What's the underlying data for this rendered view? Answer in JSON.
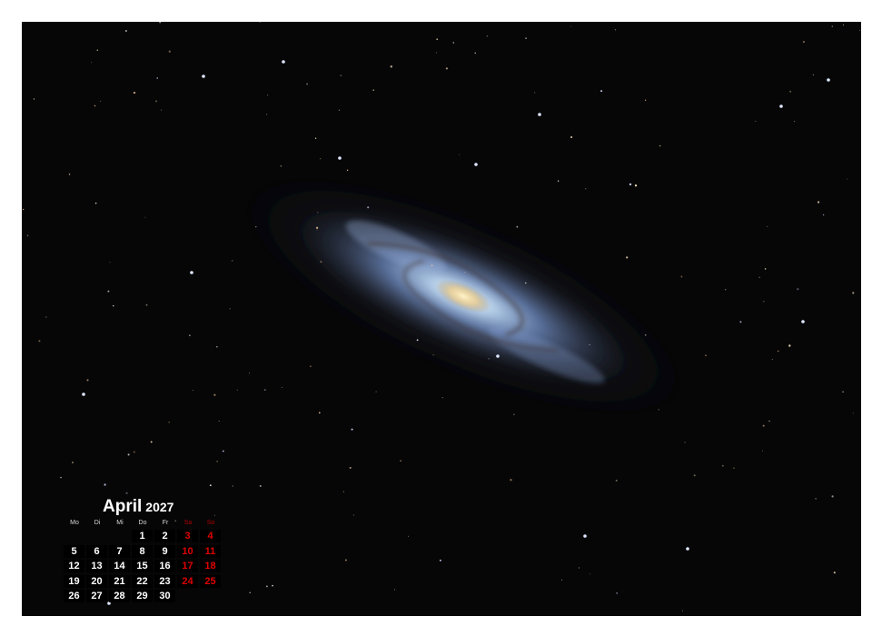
{
  "calendar": {
    "month": "April",
    "year": "2027",
    "weekdays": [
      "Mo",
      "Di",
      "Mi",
      "Do",
      "Fr",
      "Sa",
      "So"
    ],
    "weekend_color": "#e00000",
    "weeks": [
      [
        "",
        "",
        "",
        "1",
        "2",
        "3",
        "4"
      ],
      [
        "5",
        "6",
        "7",
        "8",
        "9",
        "10",
        "11"
      ],
      [
        "12",
        "13",
        "14",
        "15",
        "16",
        "17",
        "18"
      ],
      [
        "19",
        "20",
        "21",
        "22",
        "23",
        "24",
        "25"
      ],
      [
        "26",
        "27",
        "28",
        "29",
        "30",
        "",
        ""
      ]
    ]
  },
  "photo": {
    "subject": "spiral galaxy",
    "background_color": "#060606"
  }
}
